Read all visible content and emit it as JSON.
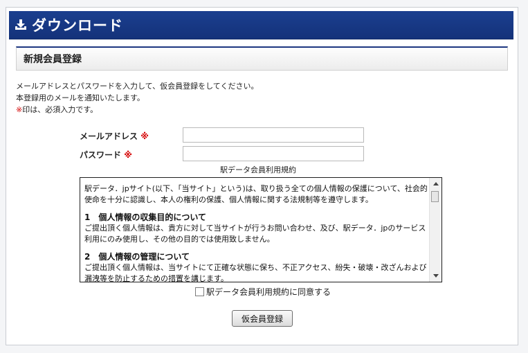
{
  "header": {
    "title": "ダウンロード",
    "icon": "download-icon"
  },
  "section": {
    "title": "新規会員登録"
  },
  "intro": {
    "line1": "メールアドレスとパスワードを入力して、仮会員登録をしてください。",
    "line2": "本登録用のメールを通知いたします。",
    "line3_mark": "※",
    "line3_text": "印は、必須入力です。"
  },
  "form": {
    "email_label": "メールアドレス",
    "password_label": "パスワード",
    "required_mark": "※",
    "email_value": "",
    "password_value": ""
  },
  "terms": {
    "title": "駅データ会員利用規約",
    "para1": "駅データ．jpサイト(以下、「当サイト」という)は、取り扱う全ての個人情報の保護について、社会的使命を十分に認識し、本人の権利の保護、個人情報に関する法規制等を遵守します。",
    "h1": "1　個人情報の収集目的について",
    "para2": "ご提出頂く個人情報は、貴方に対して当サイトが行うお問い合わせ、及び、駅データ．jpのサービス利用にのみ使用し、その他の目的では使用致しません。",
    "h2": "2　個人情報の管理について",
    "para3": "ご提出頂く個人情報は、当サイトにて正確な状態に保ち、不正アクセス、紛失・破壊・改ざんおよび漏洩等を防止するための措置を講じます。"
  },
  "agree": {
    "label": "駅データ会員利用規約に同意する",
    "checked": false
  },
  "submit": {
    "label": "仮会員登録"
  },
  "colors": {
    "header_bg": "#1b3f8f",
    "required": "#d40000"
  }
}
